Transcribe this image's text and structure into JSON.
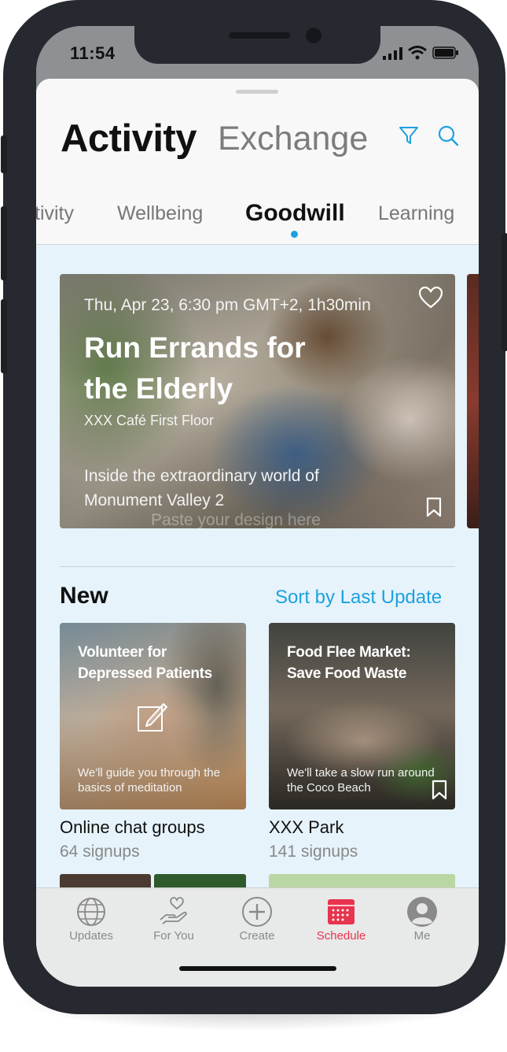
{
  "status_bar": {
    "time": "11:54"
  },
  "header": {
    "title_main": "Activity",
    "title_sub": "Exchange",
    "filter_icon": "filter-icon",
    "search_icon": "search-icon",
    "accent_color": "#1da1e0"
  },
  "tabs": [
    {
      "label": "tivity",
      "active": false
    },
    {
      "label": "Wellbeing",
      "active": false
    },
    {
      "label": "Goodwill",
      "active": true
    },
    {
      "label": "Learning",
      "active": false
    }
  ],
  "featured": {
    "date": "Thu, Apr 23, 6:30 pm GMT+2, 1h30min",
    "title": "Run Errands for the Elderly",
    "location": "XXX Café First Floor",
    "description": "Inside the extraordinary world of Monument Valley 2",
    "watermark": "Paste your design here"
  },
  "new_section": {
    "title": "New",
    "sort_label": "Sort by Last Update",
    "cards": [
      {
        "title": "Volunteer for Depressed Patients",
        "description": "We'll guide you through the basics of meditation",
        "name": "Online chat groups",
        "signups": "64 signups"
      },
      {
        "title": "Food Flee Market: Save Food Waste",
        "description": "We'll take a slow run around the Coco Beach",
        "name": "XXX Park",
        "signups": "141 signups"
      }
    ]
  },
  "tab_bar": {
    "items": [
      {
        "label": "Updates",
        "icon": "globe-icon",
        "active": false
      },
      {
        "label": "For You",
        "icon": "hand-heart-icon",
        "active": false
      },
      {
        "label": "Create",
        "icon": "plus-circle-icon",
        "active": false
      },
      {
        "label": "Schedule",
        "icon": "calendar-icon",
        "active": true
      },
      {
        "label": "Me",
        "icon": "avatar-icon",
        "active": false
      }
    ],
    "active_color": "#e8344e"
  }
}
